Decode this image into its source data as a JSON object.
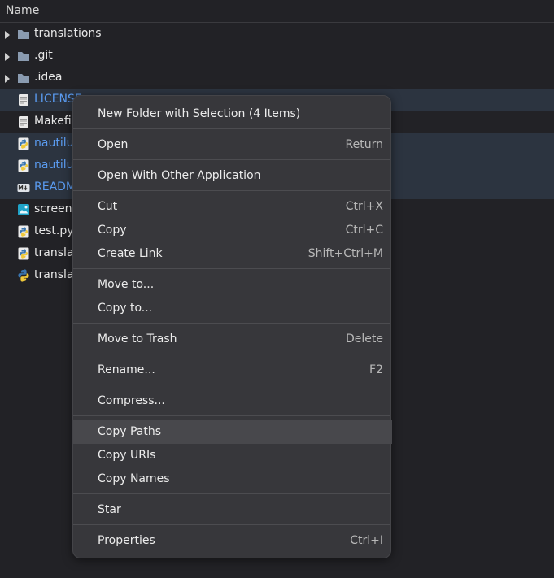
{
  "header": {
    "name_label": "Name"
  },
  "files": [
    {
      "label": "translations",
      "icon": "folder-icon",
      "expander": true,
      "selected": false
    },
    {
      "label": ".git",
      "icon": "folder-icon",
      "expander": true,
      "selected": false
    },
    {
      "label": ".idea",
      "icon": "folder-icon",
      "expander": true,
      "selected": false
    },
    {
      "label": "LICENSE",
      "icon": "text-file-icon",
      "expander": false,
      "selected": true
    },
    {
      "label": "Makefile",
      "icon": "text-file-icon",
      "expander": false,
      "selected": false
    },
    {
      "label": "nautilus",
      "icon": "python-file-icon",
      "expander": false,
      "selected": true
    },
    {
      "label": "nautilus",
      "icon": "python-file-icon",
      "expander": false,
      "selected": true
    },
    {
      "label": "README",
      "icon": "markdown-file-icon",
      "expander": false,
      "selected": true
    },
    {
      "label": "screen",
      "icon": "image-file-icon",
      "expander": false,
      "selected": false
    },
    {
      "label": "test.py",
      "icon": "python-file-icon",
      "expander": false,
      "selected": false
    },
    {
      "label": "transla",
      "icon": "python-file-icon",
      "expander": false,
      "selected": false
    },
    {
      "label": "transla",
      "icon": "python-logo-icon",
      "expander": false,
      "selected": false
    }
  ],
  "menu": {
    "new_folder": "New Folder with Selection (4 Items)",
    "open": "Open",
    "open_accel": "Return",
    "open_with": "Open With Other Application",
    "cut": "Cut",
    "cut_accel": "Ctrl+X",
    "copy": "Copy",
    "copy_accel": "Ctrl+C",
    "create_link": "Create Link",
    "create_link_accel": "Shift+Ctrl+M",
    "move_to": "Move to...",
    "copy_to": "Copy to...",
    "move_to_trash": "Move to Trash",
    "move_to_trash_accel": "Delete",
    "rename": "Rename...",
    "rename_accel": "F2",
    "compress": "Compress...",
    "copy_paths": "Copy Paths",
    "copy_uris": "Copy URIs",
    "copy_names": "Copy Names",
    "star": "Star",
    "properties": "Properties",
    "properties_accel": "Ctrl+I"
  },
  "colors": {
    "background": "#222226",
    "selected_row": "#2c3440",
    "selected_text": "#5a9bf0",
    "menu_bg": "#37373b",
    "menu_hover": "#48484c",
    "folder": "#8a9bb0"
  }
}
